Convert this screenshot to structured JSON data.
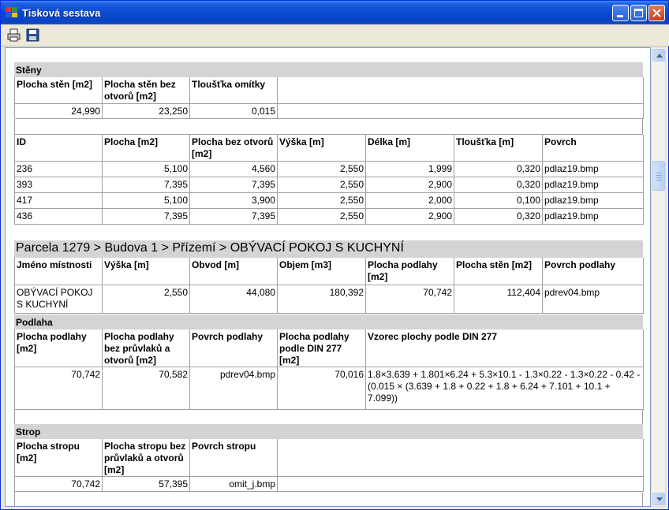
{
  "window": {
    "title": "Tisková sestava"
  },
  "toolbar": {
    "print_icon": "printer-icon",
    "save_icon": "save-disk-icon"
  },
  "steny": {
    "label": "Stěny",
    "headers": [
      "Plocha stěn [m2]",
      "Plocha stěn bez otvorů [m2]",
      "Tloušťka omítky"
    ],
    "values": [
      "24,990",
      "23,250",
      "0,015"
    ],
    "wall_headers": [
      "ID",
      "Plocha [m2]",
      "Plocha bez otvorů [m2]",
      "Výška [m]",
      "Délka [m]",
      "Tloušťka [m]",
      "Povrch"
    ],
    "walls": [
      [
        "236",
        "5,100",
        "4,560",
        "2,550",
        "1,999",
        "0,320",
        "pdlaz19.bmp"
      ],
      [
        "393",
        "7,395",
        "7,395",
        "2,550",
        "2,900",
        "0,320",
        "pdlaz19.bmp"
      ],
      [
        "417",
        "5,100",
        "3,900",
        "2,550",
        "2,000",
        "0,100",
        "pdlaz19.bmp"
      ],
      [
        "436",
        "7,395",
        "7,395",
        "2,550",
        "2,900",
        "0,320",
        "pdlaz19.bmp"
      ]
    ]
  },
  "room": {
    "title": "Parcela 1279 > Budova 1 > Přízemí > OBÝVACÍ POKOJ S KUCHYNÍ",
    "headers": [
      "Jméno místnosti",
      "Výška [m]",
      "Obvod [m]",
      "Objem [m3]",
      "Plocha podlahy [m2]",
      "Plocha stěn [m2]",
      "Povrch podlahy"
    ],
    "values": [
      "OBÝVACÍ POKOJ S KUCHYNÍ",
      "2,550",
      "44,080",
      "180,392",
      "70,742",
      "112,404",
      "pdrev04.bmp"
    ]
  },
  "podlaha": {
    "label": "Podlaha",
    "headers": [
      "Plocha podlahy [m2]",
      "Plocha podlahy bez průvlaků a otvorů [m2]",
      "Povrch podlahy",
      "Plocha podlahy podle DIN 277 [m2]",
      "Vzorec plochy podle DIN 277"
    ],
    "values": [
      "70,742",
      "70,582",
      "pdrev04.bmp",
      "70,016",
      "1.8×3.639 + 1.801×6.24 + 5.3×10.1 - 1.3×0.22 - 1.3×0.22 - 0.42 - (0.015 × (3.639 + 1.8 + 0.22 + 1.8 + 6.24 + 7.101 + 10.1 + 7.099))"
    ]
  },
  "strop": {
    "label": "Strop",
    "headers": [
      "Plocha stropu [m2]",
      "Plocha stropu bez průvlaků a otvorů [m2]",
      "Povrch stropu"
    ],
    "values": [
      "70,742",
      "57,395",
      "omit_j.bmp"
    ]
  }
}
